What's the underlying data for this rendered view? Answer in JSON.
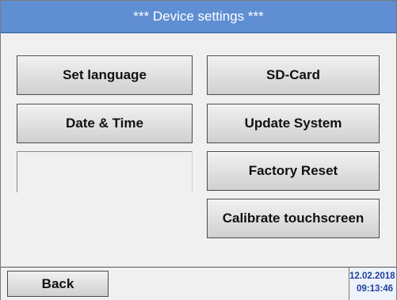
{
  "header": {
    "title": "*** Device settings ***"
  },
  "buttons": {
    "set_language": "Set language",
    "sd_card": "SD-Card",
    "date_time": "Date & Time",
    "update_system": "Update System",
    "factory_reset": "Factory Reset",
    "calibrate_touchscreen": "Calibrate touchscreen"
  },
  "footer": {
    "back": "Back",
    "date": "12.02.2018",
    "time": "09:13:46"
  },
  "colors": {
    "title_bar": "#5f8ed3",
    "datetime_text": "#1e40a0"
  }
}
